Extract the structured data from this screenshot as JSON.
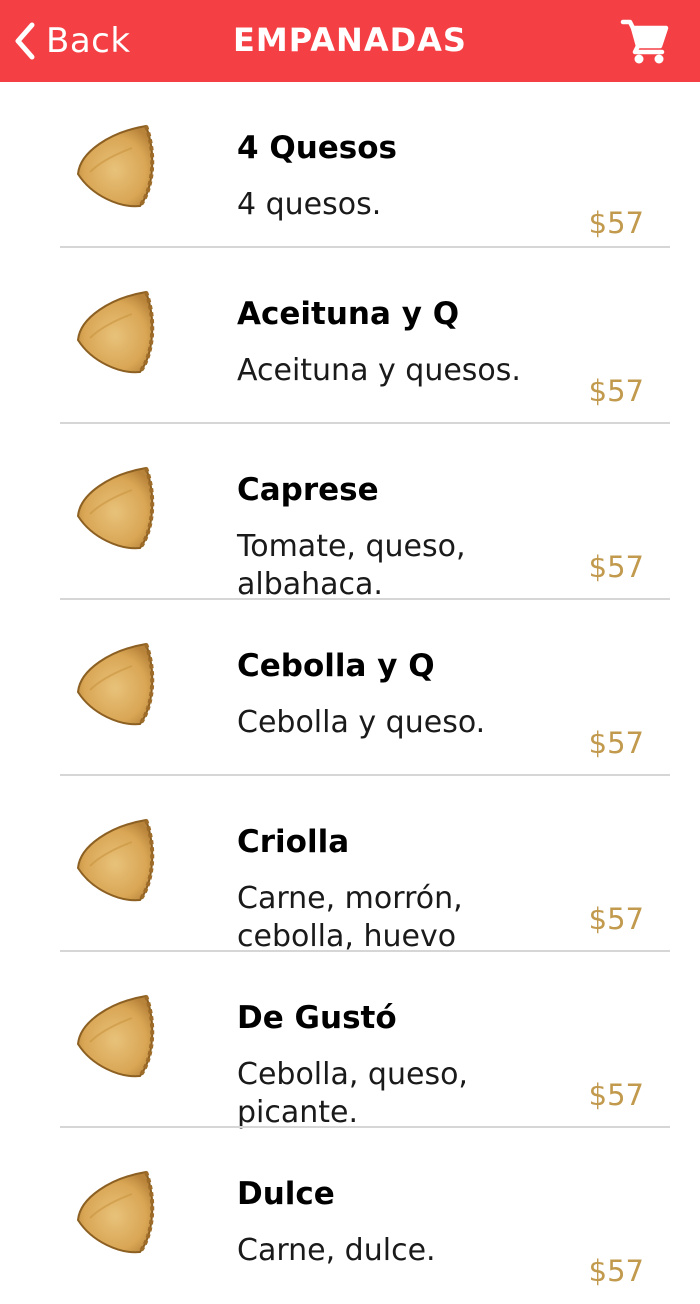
{
  "colors": {
    "header_bg": "#f43f44",
    "price": "#c29a4e",
    "divider": "#d6d6d6"
  },
  "header": {
    "back_label": "Back",
    "title": "EMPANADAS",
    "back_icon": "chevron-left-icon",
    "cart_icon": "cart-icon"
  },
  "products": [
    {
      "name": "4 Quesos",
      "description": "4 quesos.",
      "price": "$57",
      "image": "empanada-icon"
    },
    {
      "name": "Aceituna y Q",
      "description": "Aceituna y quesos.",
      "price": "$57",
      "image": "empanada-icon"
    },
    {
      "name": "Caprese",
      "description": "Tomate, queso, albahaca.",
      "price": "$57",
      "image": "empanada-icon"
    },
    {
      "name": "Cebolla y Q",
      "description": "Cebolla y queso.",
      "price": "$57",
      "image": "empanada-icon"
    },
    {
      "name": "Criolla",
      "description": "Carne, morrón, cebolla, huevo",
      "price": "$57",
      "image": "empanada-icon"
    },
    {
      "name": "De Gustó",
      "description": "Cebolla, queso, picante.",
      "price": "$57",
      "image": "empanada-icon"
    },
    {
      "name": "Dulce",
      "description": "Carne, dulce.",
      "price": "$57",
      "image": "empanada-icon"
    }
  ]
}
